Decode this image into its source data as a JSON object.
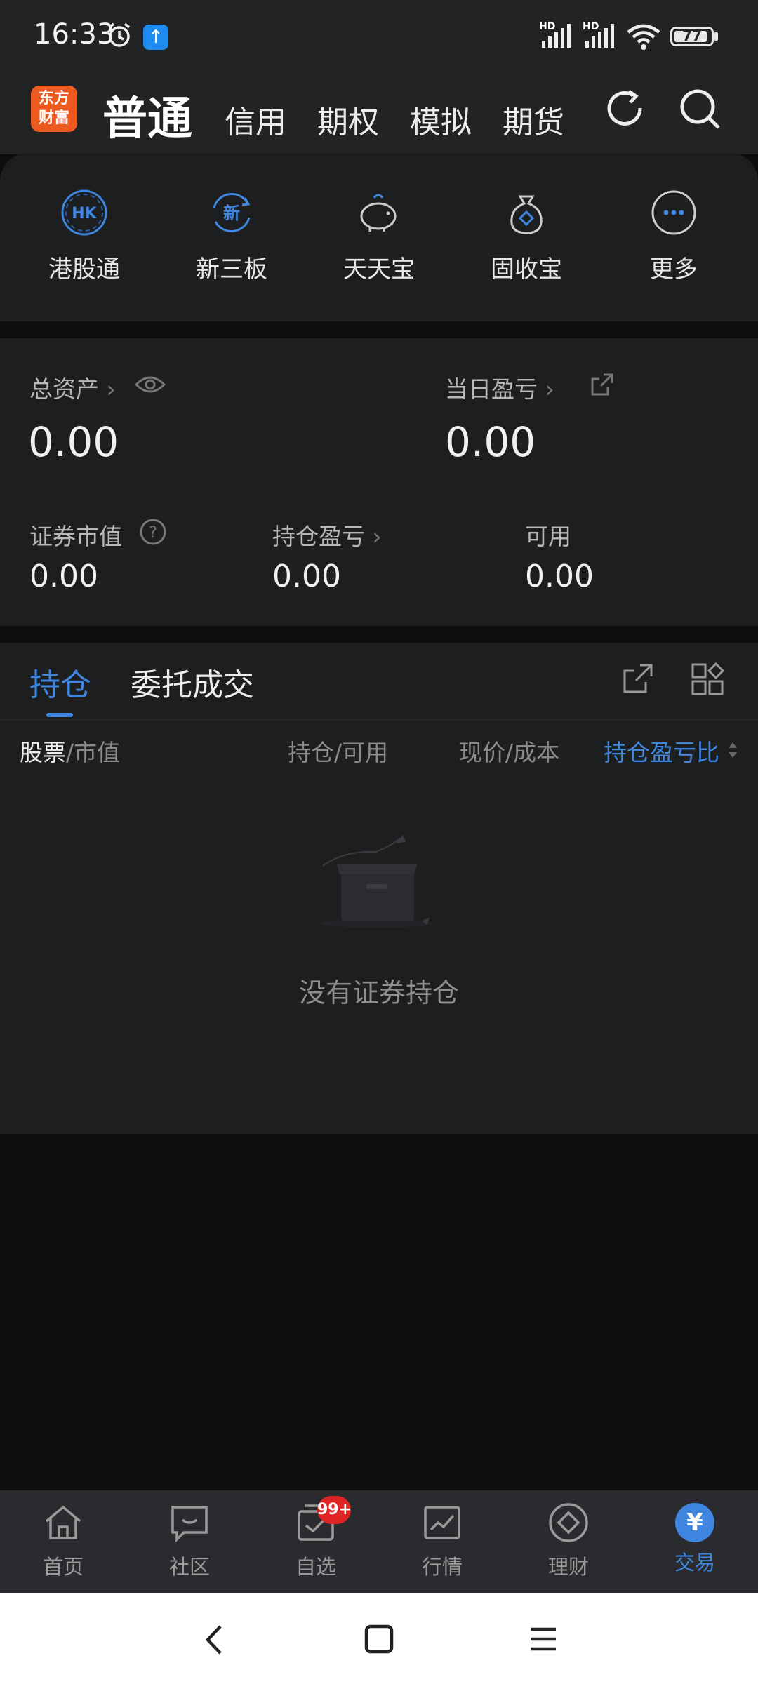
{
  "status_bar": {
    "time": "16:33",
    "battery": "77",
    "hd1": "HD",
    "hd2": "HD"
  },
  "logo": {
    "line1": "东方",
    "line2": "财富"
  },
  "top_tabs": {
    "active": "普通",
    "others": [
      "信用",
      "期权",
      "模拟",
      "期货"
    ]
  },
  "shortcuts": [
    {
      "label": "港股通",
      "icon": "hk-icon"
    },
    {
      "label": "新三板",
      "icon": "new-board-icon"
    },
    {
      "label": "天天宝",
      "icon": "piggy-bank-icon"
    },
    {
      "label": "固收宝",
      "icon": "money-bag-icon"
    },
    {
      "label": "更多",
      "icon": "more-icon"
    }
  ],
  "shortcut_icon_text": {
    "hk": "HK",
    "new": "新"
  },
  "assets": {
    "total_label": "总资产",
    "total_value": "0.00",
    "daily_label": "当日盈亏",
    "daily_value": "0.00",
    "market_label": "证券市值",
    "market_value": "0.00",
    "holding_pl_label": "持仓盈亏",
    "holding_pl_value": "0.00",
    "available_label": "可用",
    "available_value": "0.00"
  },
  "positions": {
    "tab_active": "持仓",
    "tab_other": "委托成交",
    "col_stock": "股票",
    "col_market_value": "/市值",
    "col_holding": "持仓/可用",
    "col_price": "现价/成本",
    "col_pl_ratio": "持仓盈亏比",
    "empty_text": "没有证券持仓"
  },
  "bottom_nav": {
    "items": [
      "首页",
      "社区",
      "自选",
      "行情",
      "理财",
      "交易"
    ],
    "badge": "99+",
    "trade_symbol": "¥"
  },
  "colors": {
    "accent": "#3e86e0",
    "background": "#0e0e0f",
    "card": "#1d1e20",
    "badge": "#e02424",
    "logo": "#ec5a1f"
  }
}
